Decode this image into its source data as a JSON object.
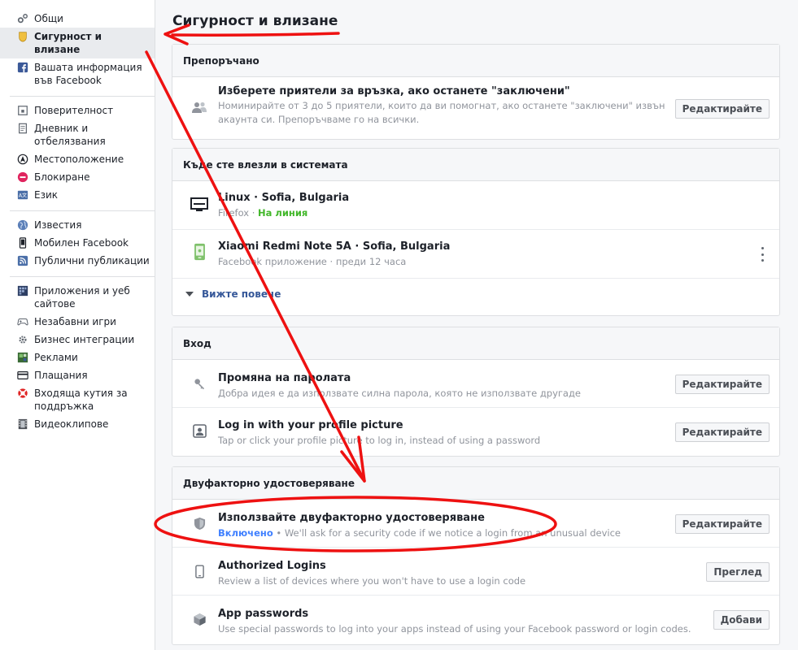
{
  "sidebar": {
    "groups": [
      [
        {
          "label": "Общи",
          "icon": "gear-icon"
        },
        {
          "label": "Сигурност и влизане",
          "icon": "shield-icon",
          "active": true
        },
        {
          "label": "Вашата информация във Facebook",
          "icon": "facebook-icon"
        }
      ],
      [
        {
          "label": "Поверителност",
          "icon": "lock-icon"
        },
        {
          "label": "Дневник и отбелязвания",
          "icon": "journal-icon"
        },
        {
          "label": "Местоположение",
          "icon": "location-icon"
        },
        {
          "label": "Блокиране",
          "icon": "block-icon"
        },
        {
          "label": "Език",
          "icon": "language-icon"
        }
      ],
      [
        {
          "label": "Известия",
          "icon": "globe-icon"
        },
        {
          "label": "Мобилен Facebook",
          "icon": "mobile-icon"
        },
        {
          "label": "Публични публикации",
          "icon": "rss-icon"
        }
      ],
      [
        {
          "label": "Приложения и уеб сайтове",
          "icon": "apps-icon"
        },
        {
          "label": "Незабавни игри",
          "icon": "gamepad-icon"
        },
        {
          "label": "Бизнес интеграции",
          "icon": "business-gear-icon"
        },
        {
          "label": "Реклами",
          "icon": "ads-icon"
        },
        {
          "label": "Плащания",
          "icon": "credit-card-icon"
        },
        {
          "label": "Входяща кутия за поддръжка",
          "icon": "lifebuoy-icon"
        },
        {
          "label": "Видеоклипове",
          "icon": "film-icon"
        }
      ]
    ]
  },
  "main": {
    "title": "Сигурност и влизане",
    "recommended": {
      "heading": "Препоръчано",
      "title": "Изберете приятели за връзка, ако останете \"заключени\"",
      "sub": "Номинирайте от 3 до 5 приятели, които да ви помогнат, ако останете \"заключени\" извън акаунта си. Препоръчваме го на всички.",
      "button": "Редактирайте"
    },
    "sessions": {
      "heading": "Къде сте влезли в системата",
      "items": [
        {
          "title": "Linux · Sofia, Bulgaria",
          "sub_prefix": "Firefox · ",
          "status": "На линия"
        },
        {
          "title": "Xiaomi Redmi Note 5A · Sofia, Bulgaria",
          "sub": "Facebook приложение · преди 12 часа"
        }
      ],
      "see_more": "Вижте повече"
    },
    "login": {
      "heading": "Вход",
      "items": [
        {
          "title": "Промяна на паролата",
          "sub": "Добра идея е да използвате силна парола, която не използвате другаде",
          "button": "Редактирайте"
        },
        {
          "title": "Log in with your profile picture",
          "sub": "Tap or click your profile picture to log in, instead of using a password",
          "button": "Редактирайте"
        }
      ]
    },
    "two_factor": {
      "heading": "Двуфакторно удостоверяване",
      "items": [
        {
          "title": "Използвайте двуфакторно удостоверяване",
          "status": "Включено",
          "sub": " • We'll ask for a security code if we notice a login from an unusual device",
          "button": "Редактирайте"
        },
        {
          "title": "Authorized Logins",
          "sub": "Review a list of devices where you won't have to use a login code",
          "button": "Преглед"
        },
        {
          "title": "App passwords",
          "sub": "Use special passwords to log into your apps instead of using your Facebook password or login codes.",
          "button": "Добави"
        }
      ]
    }
  },
  "colors": {
    "annotation": "#ee1111",
    "link": "#365899",
    "online": "#42b72a",
    "enabled": "#4080ff"
  }
}
